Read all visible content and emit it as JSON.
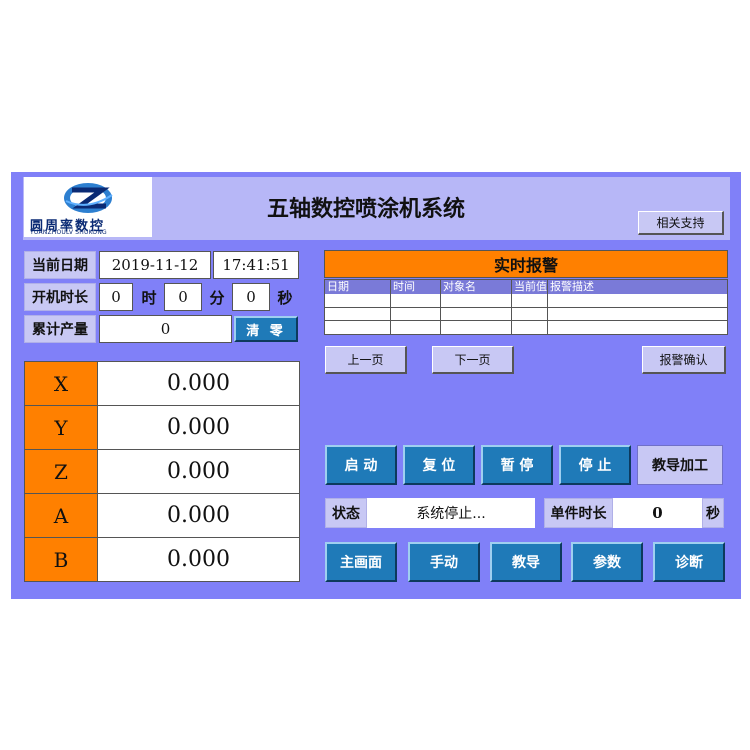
{
  "header": {
    "title": "五轴数控喷涂机系统",
    "logo_cn": "圆周率数控",
    "logo_en": "YUANZHOULV SHUKONG",
    "support_label": "相关支持"
  },
  "info": {
    "date_label": "当前日期",
    "date": "2019-11-12",
    "time": "17:41:51",
    "uptime_label": "开机时长",
    "uptime_h": "0",
    "unit_h": "时",
    "uptime_m": "0",
    "unit_m": "分",
    "uptime_s": "0",
    "unit_s": "秒",
    "output_label": "累计产量",
    "output": "0",
    "clear_label": "清 零"
  },
  "axes": [
    {
      "name": "X",
      "value": "0.000"
    },
    {
      "name": "Y",
      "value": "0.000"
    },
    {
      "name": "Z",
      "value": "0.000"
    },
    {
      "name": "A",
      "value": "0.000"
    },
    {
      "name": "B",
      "value": "0.000"
    }
  ],
  "alarm": {
    "title": "实时报警",
    "columns": [
      "日期",
      "时间",
      "对象名",
      "当前值",
      "报警描述"
    ],
    "prev_label": "上一页",
    "next_label": "下一页",
    "confirm_label": "报警确认"
  },
  "controls": {
    "start": "启 动",
    "reset": "复 位",
    "pause": "暂 停",
    "stop": "停 止",
    "teach_process": "教导加工"
  },
  "status": {
    "label": "状态",
    "value": "系统停止...",
    "cycle_label": "单件时长",
    "cycle_value": "0",
    "cycle_unit": "秒"
  },
  "nav": {
    "main": "主画面",
    "manual": "手动",
    "teach": "教导",
    "params": "参数",
    "diag": "诊断"
  },
  "colors": {
    "panel_bg": "#8080f8",
    "accent_orange": "#ff8000",
    "button_blue": "#1f7ab8"
  }
}
